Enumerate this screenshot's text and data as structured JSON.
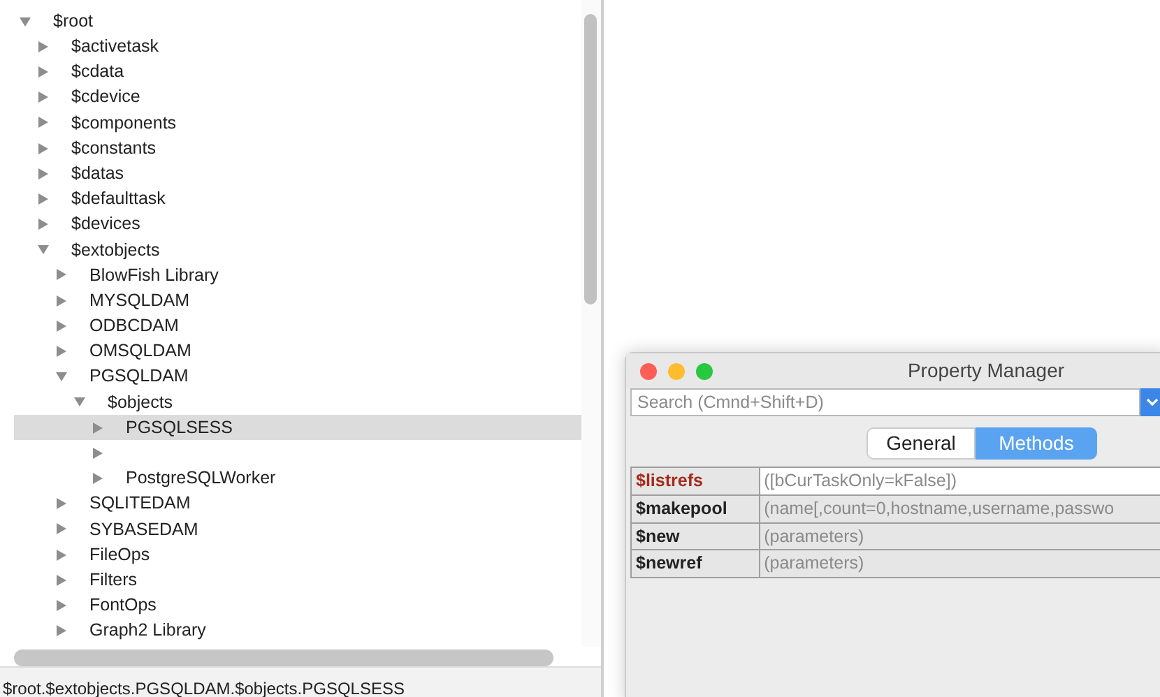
{
  "tree": [
    {
      "label": "$root",
      "expanded": true,
      "selected": false,
      "children": [
        {
          "label": "$activetask",
          "expanded": false,
          "selected": false
        },
        {
          "label": "$cdata",
          "expanded": false,
          "selected": false
        },
        {
          "label": "$cdevice",
          "expanded": false,
          "selected": false
        },
        {
          "label": "$components",
          "expanded": false,
          "selected": false
        },
        {
          "label": "$constants",
          "expanded": false,
          "selected": false
        },
        {
          "label": "$datas",
          "expanded": false,
          "selected": false
        },
        {
          "label": "$defaulttask",
          "expanded": false,
          "selected": false
        },
        {
          "label": "$devices",
          "expanded": false,
          "selected": false
        },
        {
          "label": "$extobjects",
          "expanded": true,
          "selected": false,
          "children": [
            {
              "label": "BlowFish Library",
              "expanded": false,
              "selected": false
            },
            {
              "label": "MYSQLDAM",
              "expanded": false,
              "selected": false
            },
            {
              "label": "ODBCDAM",
              "expanded": false,
              "selected": false
            },
            {
              "label": "OMSQLDAM",
              "expanded": false,
              "selected": false
            },
            {
              "label": "PGSQLDAM",
              "expanded": true,
              "selected": false,
              "children": [
                {
                  "label": "$objects",
                  "expanded": true,
                  "selected": false,
                  "children": [
                    {
                      "label": "PGSQLSESS",
                      "expanded": false,
                      "selected": true
                    },
                    {
                      "expanded": false,
                      "selected": false
                    },
                    {
                      "label": "PostgreSQLWorker",
                      "expanded": false,
                      "selected": false
                    }
                  ]
                }
              ]
            },
            {
              "label": "SQLITEDAM",
              "expanded": false,
              "selected": false
            },
            {
              "label": "SYBASEDAM",
              "expanded": false,
              "selected": false
            },
            {
              "label": "FileOps",
              "expanded": false,
              "selected": false
            },
            {
              "label": "Filters",
              "expanded": false,
              "selected": false
            },
            {
              "label": "FontOps",
              "expanded": false,
              "selected": false
            },
            {
              "label": "Graph2 Library",
              "expanded": false,
              "selected": false
            }
          ]
        }
      ]
    }
  ],
  "status_bar": "$root.$extobjects.PGSQLDAM.$objects.PGSQLSESS",
  "property_manager": {
    "title": "Property Manager",
    "search": {
      "placeholder": "Search (Cmnd+Shift+D)"
    },
    "tabs": [
      {
        "label": "General",
        "selected": false
      },
      {
        "label": "Methods",
        "selected": true
      }
    ],
    "rows": [
      {
        "name": "$listrefs",
        "params": "([bCurTaskOnly=kFalse])",
        "selected": true
      },
      {
        "name": "$makepool",
        "params": "(name[,count=0,hostname,username,passwo",
        "selected": false
      },
      {
        "name": "$new",
        "params": "(parameters)",
        "selected": false
      },
      {
        "name": "$newref",
        "params": "(parameters)",
        "selected": false
      }
    ]
  }
}
